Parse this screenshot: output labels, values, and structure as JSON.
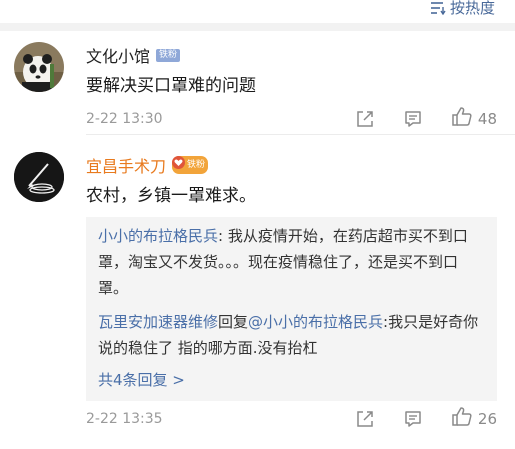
{
  "header": {
    "sort_label": "按热度"
  },
  "comments": [
    {
      "user": "文化小馆",
      "badge": "铁粉",
      "text": "要解决买口罩难的问题",
      "time": "2-22 13:30",
      "likes": "48"
    },
    {
      "user": "宜昌手术刀",
      "badge": "铁粉",
      "text": "农村，乡镇一罩难求。",
      "time": "2-22 13:35",
      "likes": "26",
      "replies": [
        {
          "user": "小小的布拉格民兵",
          "sep": ": ",
          "text": "我从疫情开始，在药店超市买不到口罩，淘宝又不发货。。。现在疫情稳住了，还是买不到口罩。"
        },
        {
          "user": "瓦里安加速器维修",
          "mid": "回复",
          "target": "@小小的布拉格民兵",
          "sep": ":",
          "text": "我只是好奇你说的稳住了 指的哪方面.没有抬杠"
        }
      ],
      "more_replies": "共4条回复 >"
    }
  ],
  "colors": {
    "link": "#4a6fa8",
    "username_orange": "#e87a1e",
    "meta_gray": "#9a9a9a"
  }
}
